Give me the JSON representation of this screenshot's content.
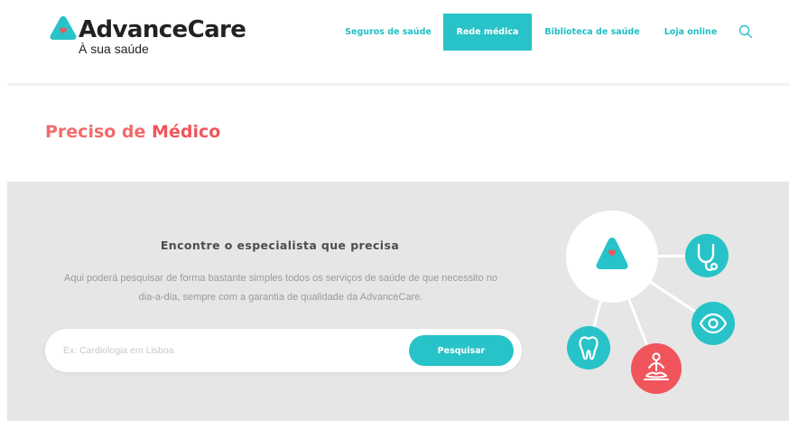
{
  "brand": {
    "name": "AdvanceCare",
    "tagline": "À sua saúde",
    "colors": {
      "teal": "#27c3c8",
      "coral": "#f0555c",
      "dark": "#222222",
      "band": "#e6e6e6"
    }
  },
  "nav": {
    "items": [
      {
        "label": "Seguros de saúde",
        "active": false
      },
      {
        "label": "Rede médica",
        "active": true
      },
      {
        "label": "Biblioteca de saúde",
        "active": false
      },
      {
        "label": "Loja online",
        "active": false
      }
    ],
    "search_icon": "search-icon"
  },
  "page": {
    "title_prefix": "Preciso de",
    "title_emphasis": "Médico"
  },
  "finder": {
    "headline": "Encontre o especialista que precisa",
    "description": "Aqui poderá pesquisar de forma bastante simples todos os serviços de saúde de que necessito no dia-a-dia, sempre com a garantia de qualidade da AdvanceCare.",
    "search": {
      "placeholder": "Ex: Cardiologia em Lisboa",
      "value": "",
      "button_label": "Pesquisar"
    }
  },
  "illustration": {
    "icons": [
      "advancecare-logo-icon",
      "stethoscope-icon",
      "eye-icon",
      "tooth-icon",
      "meditation-icon"
    ]
  }
}
